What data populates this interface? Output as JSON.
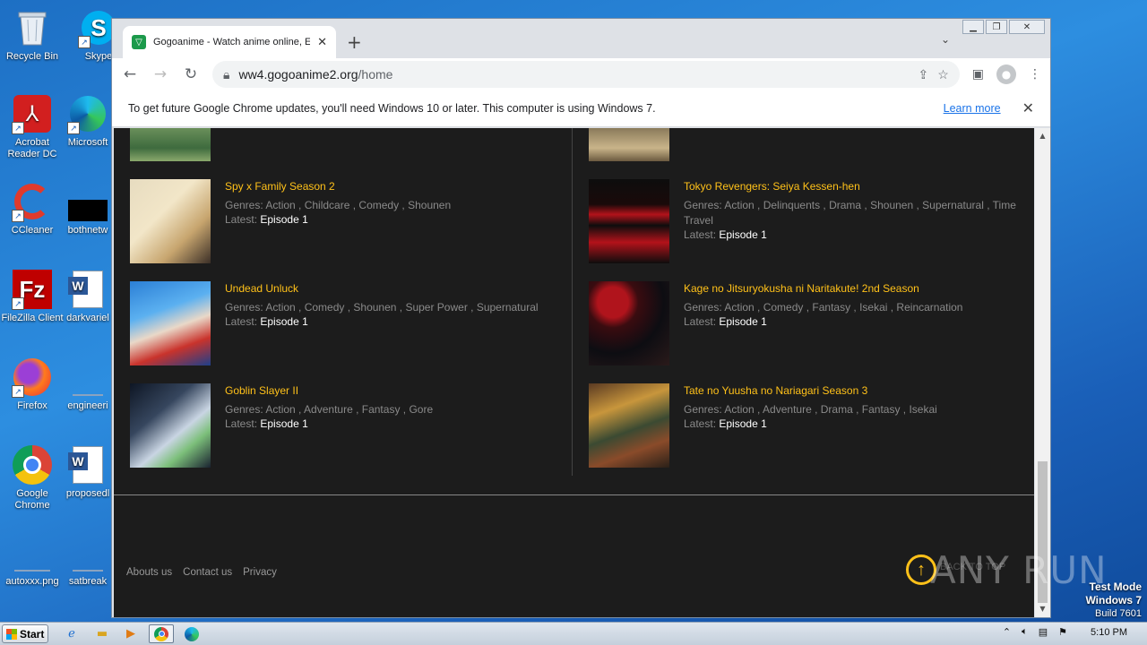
{
  "desktop": {
    "icons": [
      {
        "label": "Recycle Bin"
      },
      {
        "label": "Skype"
      },
      {
        "label": "Acrobat Reader DC"
      },
      {
        "label": "Microsoft"
      },
      {
        "label": "CCleaner"
      },
      {
        "label": "bothnetw"
      },
      {
        "label": "FileZilla Client"
      },
      {
        "label": "darkvariel"
      },
      {
        "label": "Firefox"
      },
      {
        "label": "engineeri"
      },
      {
        "label": "Google Chrome"
      },
      {
        "label": "proposedl"
      },
      {
        "label": "autoxxx.png"
      },
      {
        "label": "satbreak"
      }
    ]
  },
  "browser": {
    "tab_title": "Gogoanime - Watch anime online, Er",
    "new_tab": "+",
    "url_host": "ww4.gogoanime2.org",
    "url_path": "/home",
    "infobar_message": "To get future Google Chrome updates, you'll need Windows 10 or later. This computer is using Windows 7.",
    "infobar_link": "Learn more"
  },
  "anime": {
    "left": [
      {
        "title": "Spy x Family Season 2",
        "genres": "Genres: Action , Childcare , Comedy , Shounen",
        "latest_label": "Latest:",
        "episode": "Episode 1"
      },
      {
        "title": "Undead Unluck",
        "genres": "Genres: Action , Comedy , Shounen , Super Power , Supernatural",
        "latest_label": "Latest:",
        "episode": "Episode 1"
      },
      {
        "title": "Goblin Slayer II",
        "genres": "Genres: Action , Adventure , Fantasy , Gore",
        "latest_label": "Latest:",
        "episode": "Episode 1"
      }
    ],
    "right": [
      {
        "title": "Tokyo Revengers: Seiya Kessen-hen",
        "genres": "Genres: Action , Delinquents , Drama , Shounen , Supernatural , Time Travel",
        "latest_label": "Latest:",
        "episode": "Episode 1"
      },
      {
        "title": "Kage no Jitsuryokusha ni Naritakute! 2nd Season",
        "genres": "Genres: Action , Comedy , Fantasy , Isekai , Reincarnation",
        "latest_label": "Latest:",
        "episode": "Episode 1"
      },
      {
        "title": "Tate no Yuusha no Nariagari Season 3",
        "genres": "Genres: Action , Adventure , Drama , Fantasy , Isekai",
        "latest_label": "Latest:",
        "episode": "Episode 1"
      }
    ]
  },
  "footer": {
    "links": [
      "Abouts us",
      "Contact us",
      "Privacy"
    ],
    "back_to_top": "BACK TO TOP"
  },
  "watermark": {
    "text": "ANY RUN",
    "test_mode": "Test Mode",
    "os": "Windows 7",
    "build": "Build 7601"
  },
  "taskbar": {
    "start_label": "Start",
    "clock": "5:10 PM"
  },
  "colors": {
    "accent": "#ffc119",
    "page_bg": "#1c1c1c",
    "link": "#1a73e8"
  }
}
